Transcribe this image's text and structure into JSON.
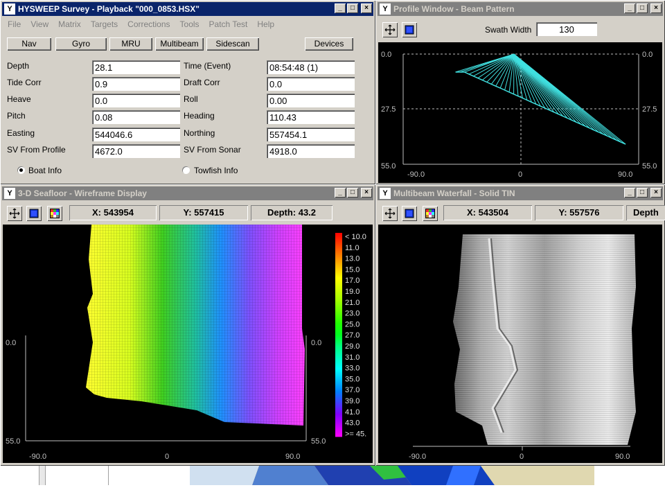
{
  "survey_window": {
    "title": "HYSWEEP Survey - Playback \"000_0853.HSX\"",
    "icon": "hysweep-app-icon",
    "menu": [
      "File",
      "View",
      "Matrix",
      "Targets",
      "Corrections",
      "Tools",
      "Patch Test",
      "Help"
    ],
    "tabs": [
      "Nav",
      "Gyro",
      "MRU",
      "Multibeam",
      "Sidescan"
    ],
    "devices_label": "Devices",
    "fields_left": [
      {
        "label": "Depth",
        "value": "28.1"
      },
      {
        "label": "Tide Corr",
        "value": "0.9"
      },
      {
        "label": "Heave",
        "value": "0.0"
      },
      {
        "label": "Pitch",
        "value": "0.08"
      },
      {
        "label": "Easting",
        "value": "544046.6"
      },
      {
        "label": "SV From Profile",
        "value": "4672.0"
      }
    ],
    "fields_right": [
      {
        "label": "Time (Event)",
        "value": "08:54:48 (1)"
      },
      {
        "label": "Draft Corr",
        "value": "0.0"
      },
      {
        "label": "Roll",
        "value": "0.00"
      },
      {
        "label": "Heading",
        "value": "110.43"
      },
      {
        "label": "Northing",
        "value": "557454.1"
      },
      {
        "label": "SV From Sonar",
        "value": "4918.0"
      }
    ],
    "radio_boat": "Boat Info",
    "radio_towfish": "Towfish Info",
    "selected_radio": "boat"
  },
  "profile_window": {
    "title": "Profile Window - Beam Pattern",
    "swath_label": "Swath Width",
    "swath_value": "130",
    "y_top": "0.0",
    "y_mid": "27.5",
    "y_bottom": "55.0",
    "x_left": "-90.0",
    "x_center": "0",
    "x_right": "90.0",
    "beam_color": "#40e0e0",
    "beam_depths": [
      9,
      9,
      9,
      10,
      11,
      12,
      13,
      14,
      15,
      16,
      17,
      18,
      19,
      20,
      21,
      22,
      23,
      24,
      25,
      26,
      27,
      28,
      29,
      30,
      31,
      32,
      33,
      34,
      35,
      36,
      37,
      38,
      39,
      40,
      41,
      42,
      43,
      44,
      45
    ]
  },
  "seafloor_window": {
    "title": "3-D Seafloor - Wireframe Display",
    "x_readout": "X: 543954",
    "y_readout": "Y: 557415",
    "depth_readout": "Depth: 43.2",
    "left_top": "0.0",
    "left_bottom": "55.0",
    "right_top": "0.0",
    "right_bottom": "55.0",
    "x_left": "-90.0",
    "x_center": "0",
    "x_right": "90.0",
    "legend": [
      "< 10.0",
      "11.0",
      "13.0",
      "15.0",
      "17.0",
      "19.0",
      "21.0",
      "23.0",
      "25.0",
      "27.0",
      "29.0",
      "31.0",
      "33.0",
      "35.0",
      "37.0",
      "39.0",
      "41.0",
      "43.0",
      ">= 45."
    ],
    "legend_colors": [
      "#ff0000",
      "#ff4000",
      "#ff8000",
      "#ffc000",
      "#ffff00",
      "#d0ff00",
      "#a0ff00",
      "#60ff00",
      "#20ff00",
      "#00ff20",
      "#00ff80",
      "#00ffc0",
      "#00ffff",
      "#00c0ff",
      "#0080ff",
      "#4040ff",
      "#8000ff",
      "#c000ff",
      "#ff00ff"
    ]
  },
  "waterfall_window": {
    "title": "Multibeam Waterfall - Solid TIN",
    "x_readout": "X: 543504",
    "y_readout": "Y: 557576",
    "depth_readout": "Depth",
    "x_left": "-90.0",
    "x_center": "0",
    "x_right": "90.0"
  },
  "colors": {
    "active_title": "#0a246a",
    "inactive_title": "#808080",
    "window_face": "#d4d0c8"
  }
}
